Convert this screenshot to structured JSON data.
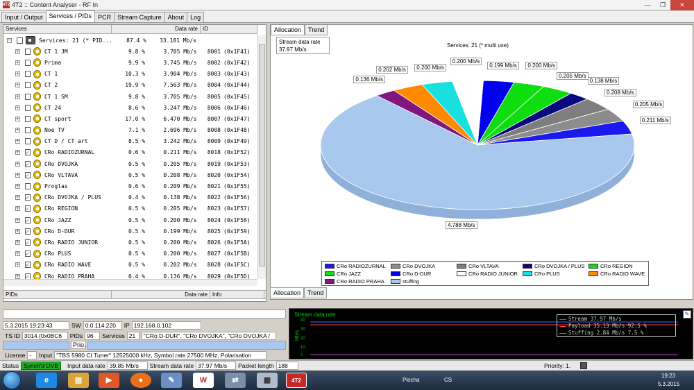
{
  "window": {
    "title": "4T2 :: Content Analyser - RF In",
    "app_icon": "4T2",
    "minimize": "—",
    "maximize": "❐",
    "close": "✕"
  },
  "tabs": [
    "Input / Output",
    "Services / PIDs",
    "PCR",
    "Stream Capture",
    "About",
    "Log"
  ],
  "services_table": {
    "headers": {
      "services": "Services",
      "rate": "Data rate",
      "id": "ID"
    },
    "root": {
      "name": "Services: 21 (* PID...",
      "pct": "87.4 %",
      "rate": "33.181 Mb/s"
    },
    "rows": [
      {
        "name": "CT 1 JM",
        "pct": "9.8 %",
        "rate": "3.705 Mb/s",
        "id": "8001",
        "hex": "(0x1F41)",
        "checked": false
      },
      {
        "name": "Prima",
        "pct": "9.9 %",
        "rate": "3.745 Mb/s",
        "id": "8002",
        "hex": "(0x1F42)",
        "checked": false
      },
      {
        "name": "CT 1",
        "pct": "10.3 %",
        "rate": "3.904 Mb/s",
        "id": "8003",
        "hex": "(0x1F43)",
        "checked": false
      },
      {
        "name": "CT 2",
        "pct": "19.9 %",
        "rate": "7.563 Mb/s",
        "id": "8004",
        "hex": "(0x1F44)",
        "checked": false
      },
      {
        "name": "CT 1 SM",
        "pct": "9.8 %",
        "rate": "3.705 Mb/s",
        "id": "8005",
        "hex": "(0x1F45)",
        "checked": false
      },
      {
        "name": "CT 24",
        "pct": "8.6 %",
        "rate": "3.247 Mb/s",
        "id": "8006",
        "hex": "(0x1F46)",
        "checked": false
      },
      {
        "name": "CT sport",
        "pct": "17.0 %",
        "rate": "6.470 Mb/s",
        "id": "8007",
        "hex": "(0x1F47)",
        "checked": false
      },
      {
        "name": "Noe TV",
        "pct": "7.1 %",
        "rate": "2.696 Mb/s",
        "id": "8008",
        "hex": "(0x1F48)",
        "checked": false
      },
      {
        "name": "CT D / CT art",
        "pct": "8.5 %",
        "rate": "3.242 Mb/s",
        "id": "8009",
        "hex": "(0x1F49)",
        "checked": false
      },
      {
        "name": "CRo RADIOZURNAL",
        "pct": "0.6 %",
        "rate": "0.211 Mb/s",
        "id": "8018",
        "hex": "(0x1F52)",
        "checked": true
      },
      {
        "name": "CRo DVOJKA",
        "pct": "0.5 %",
        "rate": "0.205 Mb/s",
        "id": "8019",
        "hex": "(0x1F53)",
        "checked": true
      },
      {
        "name": "CRo VLTAVA",
        "pct": "0.5 %",
        "rate": "0.208 Mb/s",
        "id": "8020",
        "hex": "(0x1F54)",
        "checked": true
      },
      {
        "name": "Proglas",
        "pct": "0.6 %",
        "rate": "0.209 Mb/s",
        "id": "8021",
        "hex": "(0x1F55)",
        "checked": false
      },
      {
        "name": "CRo DVOJKA / PLUS",
        "pct": "0.4 %",
        "rate": "0.138 Mb/s",
        "id": "8022",
        "hex": "(0x1F56)",
        "checked": true
      },
      {
        "name": "CRo REGION",
        "pct": "0.5 %",
        "rate": "0.205 Mb/s",
        "id": "8023",
        "hex": "(0x1F57)",
        "checked": true
      },
      {
        "name": "CRo JAZZ",
        "pct": "0.5 %",
        "rate": "0.200 Mb/s",
        "id": "8024",
        "hex": "(0x1F58)",
        "checked": true
      },
      {
        "name": "CRo D-DUR",
        "pct": "0.5 %",
        "rate": "0.199 Mb/s",
        "id": "8025",
        "hex": "(0x1F59)",
        "checked": true
      },
      {
        "name": "CRo RADIO JUNIOR",
        "pct": "0.5 %",
        "rate": "0.200 Mb/s",
        "id": "8026",
        "hex": "(0x1F5A)",
        "checked": true
      },
      {
        "name": "CRo PLUS",
        "pct": "0.5 %",
        "rate": "0.200 Mb/s",
        "id": "8027",
        "hex": "(0x1F5B)",
        "checked": true
      },
      {
        "name": "CRo RADIO WAVE",
        "pct": "0.5 %",
        "rate": "0.202 Mb/s",
        "id": "8028",
        "hex": "(0x1F5C)",
        "checked": true
      },
      {
        "name": "CRo RADIO PRAHA",
        "pct": "0.4 %",
        "rate": "0.136 Mb/s",
        "id": "8029",
        "hex": "(0x1F5D)",
        "checked": true
      }
    ]
  },
  "pids_header": {
    "pids": "PIDs",
    "rate": "Data rate",
    "info": "Info"
  },
  "right_tabs": [
    "Allocation",
    "Trend"
  ],
  "stream_box": {
    "label": "Stream data rate",
    "value": "37.97 Mb/s"
  },
  "chart_data": {
    "type": "pie",
    "title": "Services: 21 (* multi use)",
    "series": [
      {
        "name": "CRo RADIOZURNAL",
        "label": "0.211 Mb/s",
        "value": 0.211,
        "color": "#1a1aee"
      },
      {
        "name": "CRo DVOJKA",
        "label": "0.205 Mb/s",
        "value": 0.205,
        "color": "#8c8c8c"
      },
      {
        "name": "CRo VLTAVA",
        "label": "0.208 Mb/s",
        "value": 0.208,
        "color": "#7e7e7e"
      },
      {
        "name": "CRo DVOJKA / PLUS",
        "label": "0.138 Mb/s",
        "value": 0.138,
        "color": "#0a0a80"
      },
      {
        "name": "CRo REGION",
        "label": "0.205 Mb/s",
        "value": 0.205,
        "color": "#10dd10"
      },
      {
        "name": "CRo JAZZ",
        "label": "0.200 Mb/s",
        "value": 0.2,
        "color": "#10dd10"
      },
      {
        "name": "CRo D-DUR",
        "label": "0.199 Mb/s",
        "value": 0.199,
        "color": "#0000ee"
      },
      {
        "name": "CRo RADIO JUNIOR",
        "label": "0.200 Mb/s",
        "value": 0.2,
        "color": "#ffffff"
      },
      {
        "name": "CRo PLUS",
        "label": "0.200 Mb/s",
        "value": 0.2,
        "color": "#18e0e0"
      },
      {
        "name": "CRo RADIO WAVE",
        "label": "0.202 Mb/s",
        "value": 0.202,
        "color": "#ff8a00"
      },
      {
        "name": "CRo RADIO PRAHA",
        "label": "0.136 Mb/s",
        "value": 0.136,
        "color": "#80167e"
      },
      {
        "name": "stuffing",
        "label": "4.788 Mb/s",
        "value": 4.788,
        "color": "#a8c8ee"
      }
    ],
    "legend_placement": "bottom"
  },
  "info": {
    "datetime": "5.3.2015 19:23:43",
    "sw_label": "SW",
    "sw": "0.0.114.220",
    "ip_label": "IP",
    "ip": "192.168.0.102",
    "tsid_label": "TS ID",
    "tsid": "3014 (0x0BC6",
    "pids_label": "PIDs",
    "pids": "96",
    "services_label": "Services",
    "services": "21",
    "services_list": "\"CRo D-DUR\", \"CRo DVOJKA\", \"CRo DVOJKA /",
    "prio_label": "Prio.",
    "license_label": "License",
    "license": "-",
    "input_label": "Input",
    "input": "\"TBS 5980 CI Tuner\" 12525000 kHz, Symbol rate 27500 MHz, Polarisation"
  },
  "graph": {
    "title": "Stream data rate",
    "ylabel": "Mb/s",
    "yticks": [
      "40",
      "30",
      "20",
      "10",
      "0"
    ],
    "legend": [
      {
        "label": "Stream",
        "value": "37.97 Mb/s",
        "pct": "",
        "color": "#3a6cff"
      },
      {
        "label": "Payload",
        "value": "35.13 Mb/s",
        "pct": "92.5 %",
        "color": "#ff4040"
      },
      {
        "label": "Stuffing",
        "value": "2.84 Mb/s",
        "pct": "7.5 %",
        "color": "#c040c0"
      }
    ]
  },
  "status": {
    "status_label": "Status",
    "status_value": "Synch'd DVB",
    "input_rate_label": "Input data rate",
    "input_rate": "39.85 Mb/s",
    "stream_rate_label": "Stream data rate",
    "stream_rate": "37.97 Mb/s",
    "packet_label": "Packet length",
    "packet": "188",
    "priority_label": "Priority: 1."
  },
  "taskbar": {
    "desktop": "Plocha",
    "lang": "CS",
    "time": "19:23",
    "date": "5.3.2015"
  }
}
